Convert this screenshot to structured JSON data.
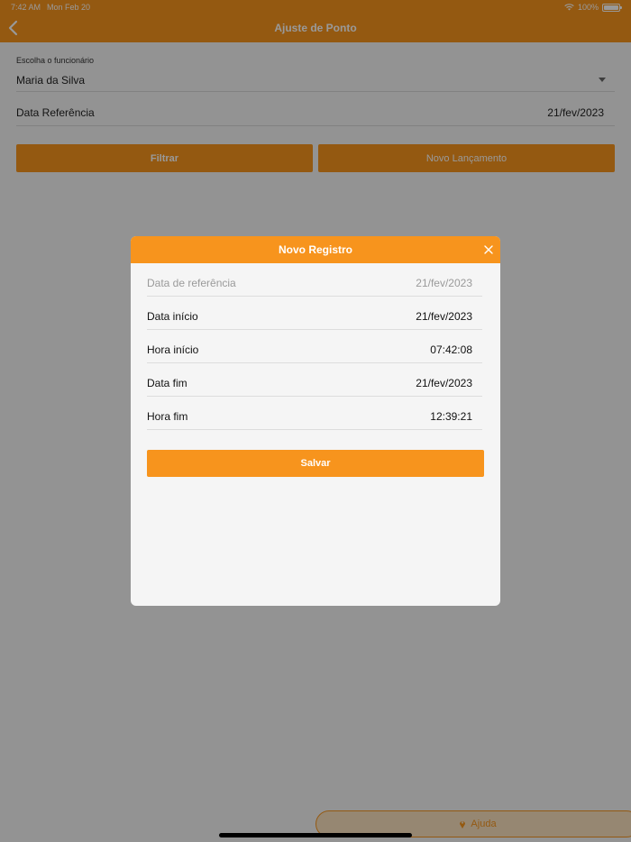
{
  "status_bar": {
    "time": "7:42 AM",
    "date": "Mon Feb 20",
    "battery": "100%"
  },
  "nav": {
    "title": "Ajuste de Ponto"
  },
  "form": {
    "employee_label": "Escolha o funcionário",
    "employee_value": "Maria da Silva",
    "ref_label": "Data Referência",
    "ref_value": "21/fev/2023",
    "filter_label": "Filtrar",
    "new_label": "Novo Lançamento"
  },
  "help": {
    "label": "Ajuda"
  },
  "modal": {
    "title": "Novo Registro",
    "rows": [
      {
        "label": "Data de referência",
        "value": "21/fev/2023",
        "disabled": true
      },
      {
        "label": "Data início",
        "value": "21/fev/2023"
      },
      {
        "label": "Hora início",
        "value": "07:42:08"
      },
      {
        "label": "Data fim",
        "value": "21/fev/2023"
      },
      {
        "label": "Hora fim",
        "value": "12:39:21"
      }
    ],
    "save_label": "Salvar"
  },
  "colors": {
    "accent": "#f7941d",
    "overlay": "rgba(0,0,0,0.4)"
  }
}
